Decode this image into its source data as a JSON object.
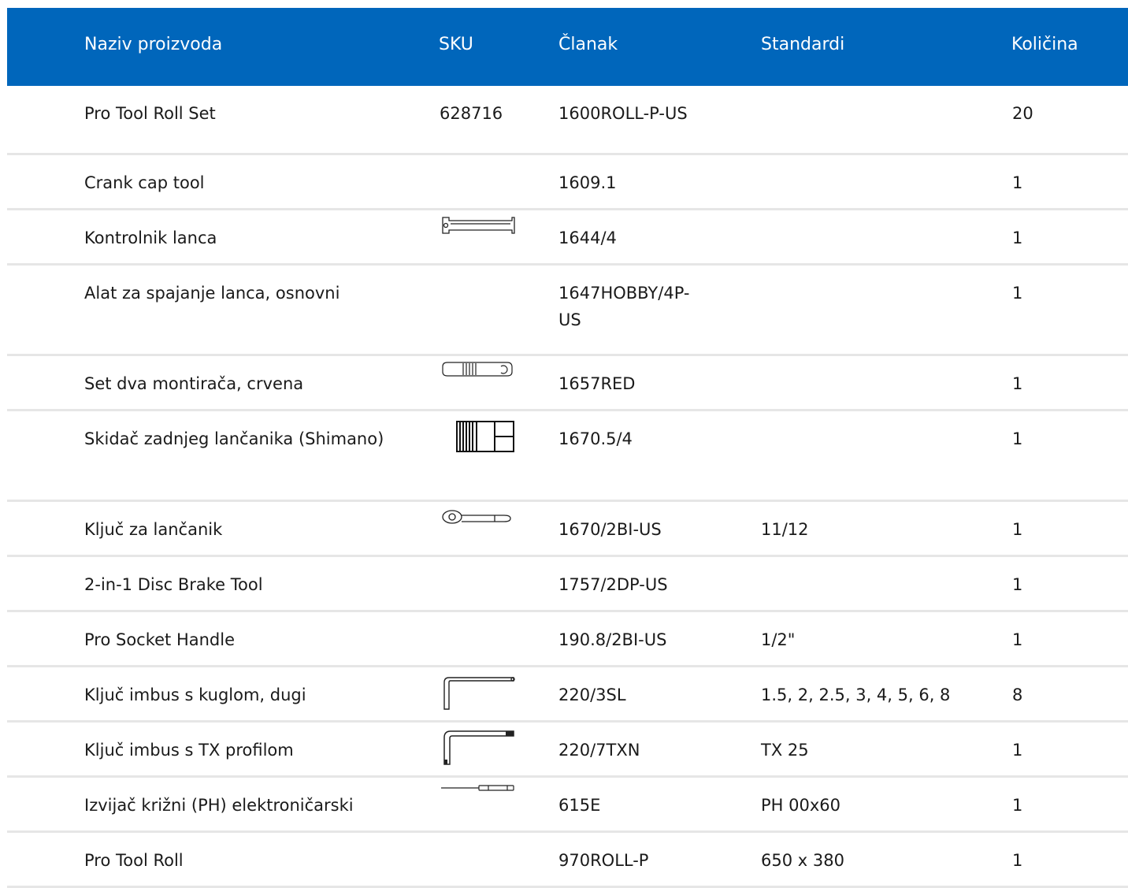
{
  "colors": {
    "header_bg": "#0066bb",
    "header_text": "#ffffff",
    "divider": "#e6e6e6"
  },
  "headers": {
    "name": "Naziv proizvoda",
    "sku": "SKU",
    "article": "Članak",
    "standards": "Standardi",
    "quantity": "Količina"
  },
  "rows": [
    {
      "name": "Pro Tool Roll Set",
      "sku": "628716",
      "article": "1600ROLL-P-US",
      "standards": "",
      "quantity": "20",
      "icon": ""
    },
    {
      "name": "Crank cap tool",
      "sku": "",
      "article": "1609.1",
      "standards": "",
      "quantity": "1",
      "icon": ""
    },
    {
      "name": "Kontrolnik lanca",
      "sku": "",
      "article": "1644/4",
      "standards": "",
      "quantity": "1",
      "icon": "chain-checker-icon"
    },
    {
      "name": "Alat za spajanje lanca, osnovni",
      "sku": "",
      "article": "1647HOBBY/4P-US",
      "standards": "",
      "quantity": "1",
      "icon": ""
    },
    {
      "name": "Set dva montirača, crvena",
      "sku": "",
      "article": "1657RED",
      "standards": "",
      "quantity": "1",
      "icon": "tire-lever-icon"
    },
    {
      "name": "Skidač zadnjeg lančanika (Shimano)",
      "sku": "",
      "article": "1670.5/4",
      "standards": "",
      "quantity": "1",
      "icon": "cassette-remover-icon"
    },
    {
      "name": "Ključ za lančanik",
      "sku": "",
      "article": "1670/2BI-US",
      "standards": "11/12",
      "quantity": "1",
      "icon": "chain-whip-icon"
    },
    {
      "name": "2-in-1 Disc Brake Tool",
      "sku": "",
      "article": "1757/2DP-US",
      "standards": "",
      "quantity": "1",
      "icon": ""
    },
    {
      "name": "Pro Socket Handle",
      "sku": "",
      "article": "190.8/2BI-US",
      "standards": "1/2\"",
      "quantity": "1",
      "icon": ""
    },
    {
      "name": "Ključ imbus s kuglom, dugi",
      "sku": "",
      "article": "220/3SL",
      "standards": "1.5, 2, 2.5, 3, 4, 5, 6, 8",
      "quantity": "8",
      "icon": "hex-key-icon"
    },
    {
      "name": "Ključ imbus s TX profilom",
      "sku": "",
      "article": "220/7TXN",
      "standards": "TX 25",
      "quantity": "1",
      "icon": "torx-key-icon"
    },
    {
      "name": "Izvijač križni (PH) elektroničarski",
      "sku": "",
      "article": "615E",
      "standards": "PH 00x60",
      "quantity": "1",
      "icon": "screwdriver-icon"
    },
    {
      "name": "Pro Tool Roll",
      "sku": "",
      "article": "970ROLL-P",
      "standards": "650 x 380",
      "quantity": "1",
      "icon": ""
    }
  ]
}
